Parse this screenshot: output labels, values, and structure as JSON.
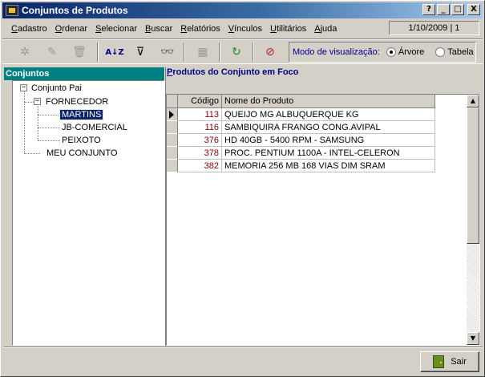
{
  "window": {
    "title": "Conjuntos de Produtos",
    "buttons": {
      "help": "?",
      "minimize": "_",
      "maximize": "□",
      "close": "X"
    }
  },
  "menu": [
    {
      "first": "C",
      "rest": "adastro"
    },
    {
      "first": "O",
      "rest": "rdenar"
    },
    {
      "first": "S",
      "rest": "elecionar"
    },
    {
      "first": "B",
      "rest": "uscar"
    },
    {
      "first": "R",
      "rest": "elatórios"
    },
    {
      "first": "V",
      "rest": "ínculos"
    },
    {
      "first": "U",
      "rest": "tilitários"
    },
    {
      "first": "A",
      "rest": "juda"
    }
  ],
  "status": {
    "date_session": "1/10/2009 | 1"
  },
  "toolbar": {
    "icons": [
      "new-icon",
      "edit-icon",
      "delete-icon",
      "sort-az-icon",
      "filter-icon",
      "binoculars-icon",
      "page-icon",
      "refresh-icon",
      "clear-icon"
    ],
    "glyphs": {
      "new": "✲",
      "edit": "✎",
      "delete": "🗑",
      "sort": "A↓Z",
      "filter": "⊽",
      "find": "👓",
      "page": "▦",
      "refresh": "↻",
      "clear": "⊘"
    }
  },
  "view_mode": {
    "label": "Modo de visualização:",
    "options": [
      {
        "label": "Árvore",
        "checked": true
      },
      {
        "label": "Tabela",
        "checked": false
      }
    ]
  },
  "tree": {
    "header": "Conjuntos",
    "nodes": [
      {
        "label": "Conjunto Pai",
        "level": 0,
        "expanded": true
      },
      {
        "label": "FORNECEDOR",
        "level": 1,
        "expanded": true
      },
      {
        "label": "MARTINS",
        "level": 2,
        "selected": true
      },
      {
        "label": "JB-COMERCIAL",
        "level": 2
      },
      {
        "label": "PEIXOTO",
        "level": 2
      },
      {
        "label": "MEU CONJUNTO",
        "level": 1
      }
    ]
  },
  "products": {
    "header_first": "P",
    "header_rest": "rodutos do Conjunto em Foco",
    "columns": {
      "code": "Código",
      "name": "Nome do Produto"
    },
    "rows": [
      {
        "code": "113",
        "name": "QUEIJO MG ALBUQUERQUE KG",
        "current": true
      },
      {
        "code": "116",
        "name": "SAMBIQUIRA FRANGO CONG.AVIPAL"
      },
      {
        "code": "376",
        "name": "HD  40GB - 5400 RPM - SAMSUNG"
      },
      {
        "code": "378",
        "name": "PROC. PENTIUM 1100A - INTEL-CELERON"
      },
      {
        "code": "382",
        "name": "MEMORIA 256 MB 168 VIAS DIM SRAM"
      }
    ]
  },
  "footer": {
    "exit_label": "Sair"
  }
}
